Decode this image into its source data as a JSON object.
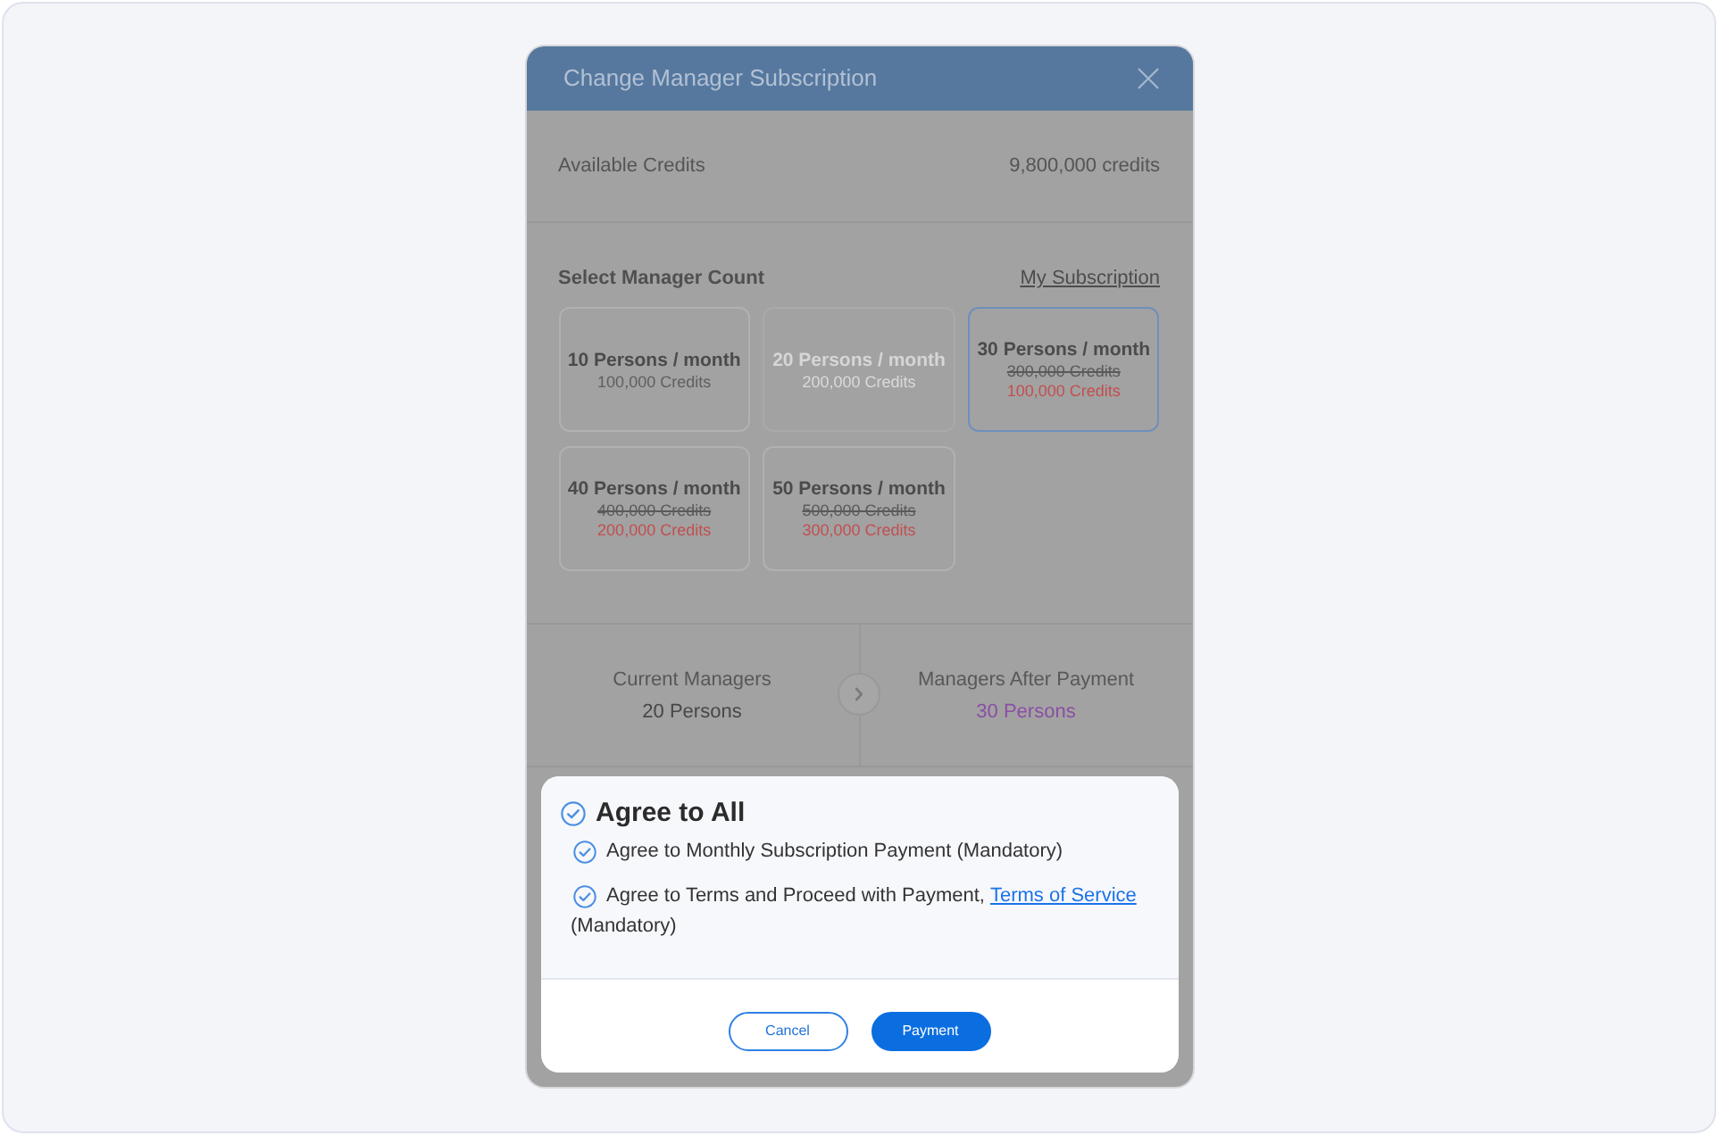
{
  "dialog": {
    "title": "Change Manager Subscription"
  },
  "available_credits": {
    "label": "Available Credits",
    "value": "9,800,000 credits"
  },
  "manager_count": {
    "heading": "Select Manager Count",
    "link": "My Subscription",
    "options": [
      {
        "label": "10 Persons / month",
        "price": "100,000 Credits",
        "selected": false,
        "disabled": false
      },
      {
        "label": "20 Persons / month",
        "price": "200,000 Credits",
        "selected": false,
        "disabled": true
      },
      {
        "label": "30 Persons / month",
        "original_price": "300,000 Credits",
        "price": "100,000 Credits",
        "selected": true,
        "disabled": false
      },
      {
        "label": "40 Persons / month",
        "original_price": "400,000 Credits",
        "price": "200,000 Credits",
        "selected": false,
        "disabled": false
      },
      {
        "label": "50 Persons / month",
        "original_price": "500,000 Credits",
        "price": "300,000 Credits",
        "selected": false,
        "disabled": false
      }
    ]
  },
  "summary": {
    "current": {
      "label": "Current Managers",
      "value": "20 Persons"
    },
    "after": {
      "label": "Managers After Payment",
      "value": "30 Persons"
    }
  },
  "agreement": {
    "agree_all": {
      "label": "Agree to All",
      "checked": true
    },
    "items": [
      {
        "text": "Agree to Monthly Subscription Payment (Mandatory)",
        "checked": true
      },
      {
        "text": "Agree to Terms and Proceed with Payment,",
        "link": "Terms of Service",
        "text_after": "(Mandatory)",
        "checked": true
      }
    ]
  },
  "buttons": [
    {
      "label": "Cancel",
      "kind": "secondary"
    },
    {
      "label": "Payment",
      "kind": "primary"
    }
  ]
}
